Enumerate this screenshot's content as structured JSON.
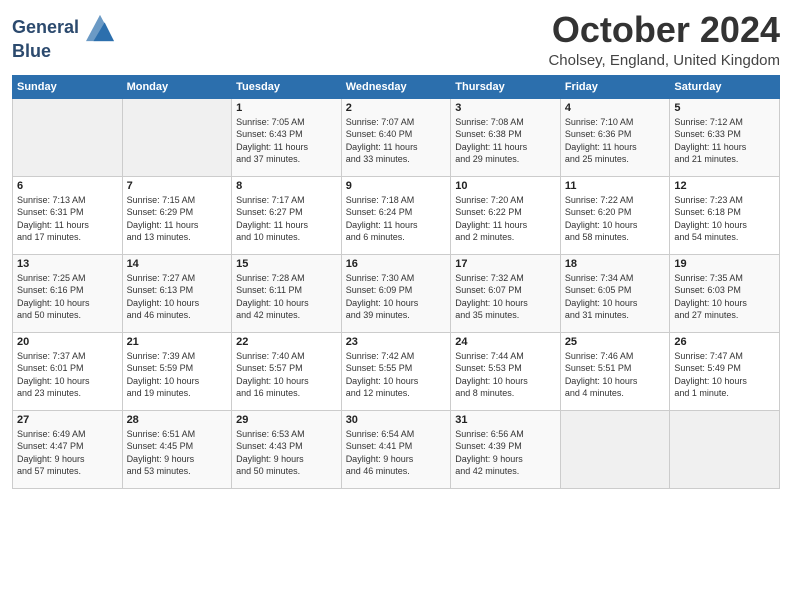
{
  "logo": {
    "line1": "General",
    "line2": "Blue"
  },
  "title": "October 2024",
  "location": "Cholsey, England, United Kingdom",
  "days_of_week": [
    "Sunday",
    "Monday",
    "Tuesday",
    "Wednesday",
    "Thursday",
    "Friday",
    "Saturday"
  ],
  "weeks": [
    [
      {
        "day": "",
        "info": ""
      },
      {
        "day": "",
        "info": ""
      },
      {
        "day": "1",
        "info": "Sunrise: 7:05 AM\nSunset: 6:43 PM\nDaylight: 11 hours\nand 37 minutes."
      },
      {
        "day": "2",
        "info": "Sunrise: 7:07 AM\nSunset: 6:40 PM\nDaylight: 11 hours\nand 33 minutes."
      },
      {
        "day": "3",
        "info": "Sunrise: 7:08 AM\nSunset: 6:38 PM\nDaylight: 11 hours\nand 29 minutes."
      },
      {
        "day": "4",
        "info": "Sunrise: 7:10 AM\nSunset: 6:36 PM\nDaylight: 11 hours\nand 25 minutes."
      },
      {
        "day": "5",
        "info": "Sunrise: 7:12 AM\nSunset: 6:33 PM\nDaylight: 11 hours\nand 21 minutes."
      }
    ],
    [
      {
        "day": "6",
        "info": "Sunrise: 7:13 AM\nSunset: 6:31 PM\nDaylight: 11 hours\nand 17 minutes."
      },
      {
        "day": "7",
        "info": "Sunrise: 7:15 AM\nSunset: 6:29 PM\nDaylight: 11 hours\nand 13 minutes."
      },
      {
        "day": "8",
        "info": "Sunrise: 7:17 AM\nSunset: 6:27 PM\nDaylight: 11 hours\nand 10 minutes."
      },
      {
        "day": "9",
        "info": "Sunrise: 7:18 AM\nSunset: 6:24 PM\nDaylight: 11 hours\nand 6 minutes."
      },
      {
        "day": "10",
        "info": "Sunrise: 7:20 AM\nSunset: 6:22 PM\nDaylight: 11 hours\nand 2 minutes."
      },
      {
        "day": "11",
        "info": "Sunrise: 7:22 AM\nSunset: 6:20 PM\nDaylight: 10 hours\nand 58 minutes."
      },
      {
        "day": "12",
        "info": "Sunrise: 7:23 AM\nSunset: 6:18 PM\nDaylight: 10 hours\nand 54 minutes."
      }
    ],
    [
      {
        "day": "13",
        "info": "Sunrise: 7:25 AM\nSunset: 6:16 PM\nDaylight: 10 hours\nand 50 minutes."
      },
      {
        "day": "14",
        "info": "Sunrise: 7:27 AM\nSunset: 6:13 PM\nDaylight: 10 hours\nand 46 minutes."
      },
      {
        "day": "15",
        "info": "Sunrise: 7:28 AM\nSunset: 6:11 PM\nDaylight: 10 hours\nand 42 minutes."
      },
      {
        "day": "16",
        "info": "Sunrise: 7:30 AM\nSunset: 6:09 PM\nDaylight: 10 hours\nand 39 minutes."
      },
      {
        "day": "17",
        "info": "Sunrise: 7:32 AM\nSunset: 6:07 PM\nDaylight: 10 hours\nand 35 minutes."
      },
      {
        "day": "18",
        "info": "Sunrise: 7:34 AM\nSunset: 6:05 PM\nDaylight: 10 hours\nand 31 minutes."
      },
      {
        "day": "19",
        "info": "Sunrise: 7:35 AM\nSunset: 6:03 PM\nDaylight: 10 hours\nand 27 minutes."
      }
    ],
    [
      {
        "day": "20",
        "info": "Sunrise: 7:37 AM\nSunset: 6:01 PM\nDaylight: 10 hours\nand 23 minutes."
      },
      {
        "day": "21",
        "info": "Sunrise: 7:39 AM\nSunset: 5:59 PM\nDaylight: 10 hours\nand 19 minutes."
      },
      {
        "day": "22",
        "info": "Sunrise: 7:40 AM\nSunset: 5:57 PM\nDaylight: 10 hours\nand 16 minutes."
      },
      {
        "day": "23",
        "info": "Sunrise: 7:42 AM\nSunset: 5:55 PM\nDaylight: 10 hours\nand 12 minutes."
      },
      {
        "day": "24",
        "info": "Sunrise: 7:44 AM\nSunset: 5:53 PM\nDaylight: 10 hours\nand 8 minutes."
      },
      {
        "day": "25",
        "info": "Sunrise: 7:46 AM\nSunset: 5:51 PM\nDaylight: 10 hours\nand 4 minutes."
      },
      {
        "day": "26",
        "info": "Sunrise: 7:47 AM\nSunset: 5:49 PM\nDaylight: 10 hours\nand 1 minute."
      }
    ],
    [
      {
        "day": "27",
        "info": "Sunrise: 6:49 AM\nSunset: 4:47 PM\nDaylight: 9 hours\nand 57 minutes."
      },
      {
        "day": "28",
        "info": "Sunrise: 6:51 AM\nSunset: 4:45 PM\nDaylight: 9 hours\nand 53 minutes."
      },
      {
        "day": "29",
        "info": "Sunrise: 6:53 AM\nSunset: 4:43 PM\nDaylight: 9 hours\nand 50 minutes."
      },
      {
        "day": "30",
        "info": "Sunrise: 6:54 AM\nSunset: 4:41 PM\nDaylight: 9 hours\nand 46 minutes."
      },
      {
        "day": "31",
        "info": "Sunrise: 6:56 AM\nSunset: 4:39 PM\nDaylight: 9 hours\nand 42 minutes."
      },
      {
        "day": "",
        "info": ""
      },
      {
        "day": "",
        "info": ""
      }
    ]
  ]
}
